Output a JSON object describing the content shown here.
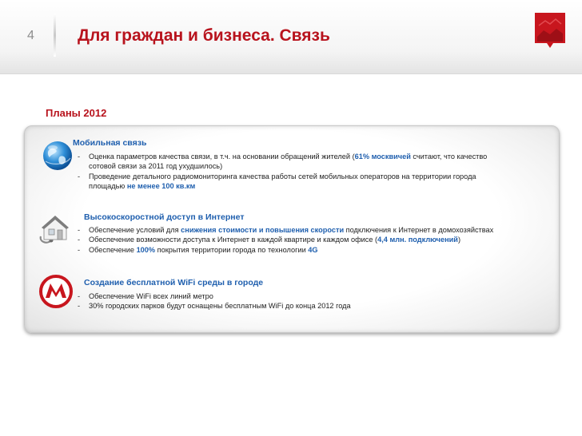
{
  "header": {
    "page_number": "4",
    "title": "Для граждан и бизнеса. Связь"
  },
  "plans_title": "Планы 2012",
  "colors": {
    "title_red": "#b8131d",
    "accent_blue": "#1f5fae"
  },
  "sections": [
    {
      "icon": "globe-icon",
      "heading": "Мобильная связь",
      "bullets": [
        {
          "p1": "Оценка параметров качества связи,  в т.ч. на основании обращений жителей (",
          "hl1": "61% москвичей",
          "p2": " считают, что качество",
          "line2": "сотовой связи за 2011 год ухудшилось)"
        },
        {
          "p1": "Проведение детального радиомониторинга качества работы сетей мобильных операторов на территории города",
          "line2_p1": "площадью ",
          "line2_hl": "не менее 100 кв.км"
        }
      ]
    },
    {
      "icon": "house-icon",
      "heading": "Высокоскоростной доступ в Интернет",
      "bullets": [
        {
          "p1": "Обеспечение условий для ",
          "hl1": "снижения стоимости  и повышения скорости",
          "p2": " подключения к Интернет в домохозяйствах"
        },
        {
          "p1": "Обеспечение возможности доступа к Интернет в каждой квартире и каждом офисе (",
          "hl1": "4,4 млн. подключений",
          "p2": ")"
        },
        {
          "p1": "Обеспечение ",
          "hl1": "100%",
          "p2": " покрытия территории города по технологии ",
          "hl2": "4G"
        }
      ]
    },
    {
      "icon": "metro-icon",
      "heading": "Создание бесплатной WiFi среды в городе",
      "bullets": [
        {
          "p1": "Обеспечение WiFi всех линий метро"
        },
        {
          "p1": "30% городских парков будут оснащены бесплатным WiFi до конца 2012 года"
        }
      ]
    }
  ]
}
